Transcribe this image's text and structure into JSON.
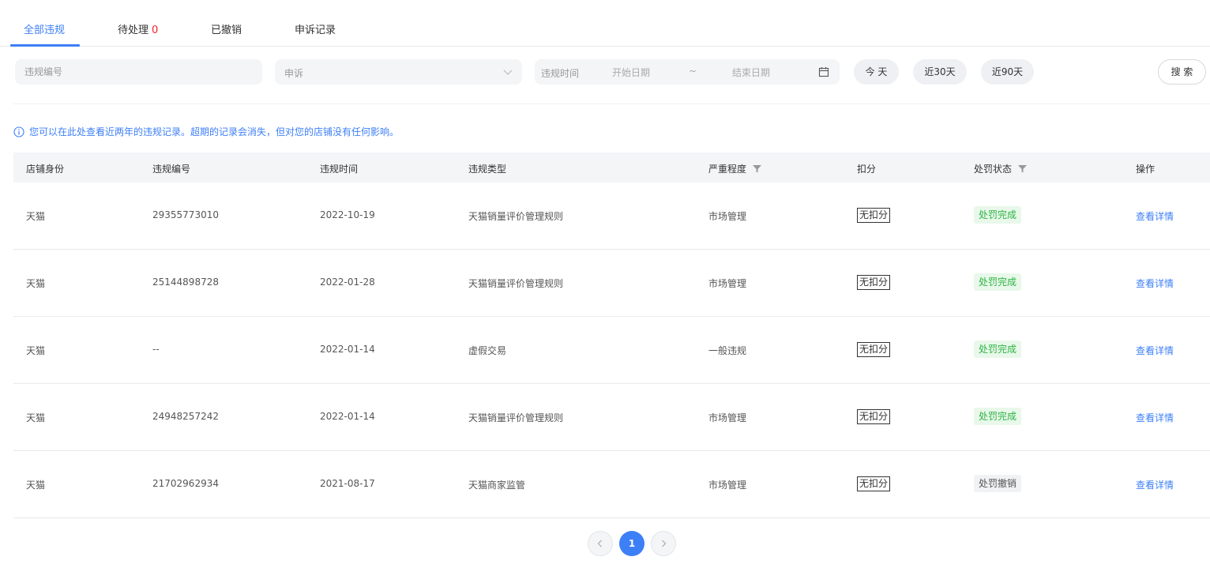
{
  "tabs": [
    {
      "label": "全部违规"
    },
    {
      "label": "待处理",
      "count": "0"
    },
    {
      "label": "已撤销"
    },
    {
      "label": "申诉记录"
    }
  ],
  "filters": {
    "violation_no_placeholder": "违规编号",
    "appeal_select_value": "申诉",
    "date_label": "违规时间",
    "start_date_placeholder": "开始日期",
    "date_separator": "~",
    "end_date_placeholder": "结束日期",
    "quick_today": "今 天",
    "quick_30": "近30天",
    "quick_90": "近90天",
    "search_button": "搜 索"
  },
  "notice": "您可以在此处查看近两年的违规记录。超期的记录会消失，但对您的店铺没有任何影响。",
  "table": {
    "headers": {
      "shop_identity": "店铺身份",
      "violation_no": "违规编号",
      "violation_time": "违规时间",
      "violation_type": "违规类型",
      "severity": "严重程度",
      "deduction": "扣分",
      "penalty_status": "处罚状态",
      "action": "操作"
    },
    "rows": [
      {
        "shop": "天猫",
        "no": "29355773010",
        "time": "2022-10-19",
        "type": "天猫销量评价管理规则",
        "severity": "市场管理",
        "deduction": "无扣分",
        "status": "处罚完成",
        "action": "查看详情"
      },
      {
        "shop": "天猫",
        "no": "25144898728",
        "time": "2022-01-28",
        "type": "天猫销量评价管理规则",
        "severity": "市场管理",
        "deduction": "无扣分",
        "status": "处罚完成",
        "action": "查看详情"
      },
      {
        "shop": "天猫",
        "no": "--",
        "time": "2022-01-14",
        "type": "虚假交易",
        "severity": "一般违规",
        "deduction": "无扣分",
        "status": "处罚完成",
        "action": "查看详情"
      },
      {
        "shop": "天猫",
        "no": "24948257242",
        "time": "2022-01-14",
        "type": "天猫销量评价管理规则",
        "severity": "市场管理",
        "deduction": "无扣分",
        "status": "处罚完成",
        "action": "查看详情"
      },
      {
        "shop": "天猫",
        "no": "21702962934",
        "time": "2021-08-17",
        "type": "天猫商家监管",
        "severity": "市场管理",
        "deduction": "无扣分",
        "status": "处罚撤销",
        "action": "查看详情"
      }
    ]
  },
  "pagination": {
    "current_page": "1"
  },
  "colors": {
    "accent": "#3d7ff7",
    "done_green": "#2fb344",
    "pending_red": "#f5222d"
  }
}
